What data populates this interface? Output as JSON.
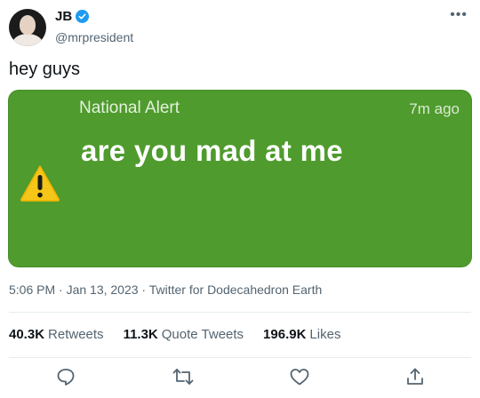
{
  "author": {
    "display_name": "JB",
    "handle": "@mrpresident",
    "verified": true,
    "more_icon": "more-horizontal-icon"
  },
  "tweet": {
    "text": "hey guys"
  },
  "media": {
    "alert_title": "National Alert",
    "alert_time": "7m ago",
    "alert_body": "are you mad at me",
    "icon": "warning-triangle-icon",
    "background_color": "#4f9b2e"
  },
  "meta": {
    "text": "5:06 PM · Jan 13, 2023 · Twitter for Dodecahedron Earth"
  },
  "stats": {
    "retweets_count": "40.3K",
    "retweets_label": "Retweets",
    "quotes_count": "11.3K",
    "quotes_label": "Quote Tweets",
    "likes_count": "196.9K",
    "likes_label": "Likes"
  },
  "actions": {
    "reply_icon": "reply-icon",
    "retweet_icon": "retweet-icon",
    "like_icon": "heart-icon",
    "share_icon": "share-icon"
  },
  "colors": {
    "accent": "#1d9bf0",
    "secondary_text": "#536471"
  }
}
